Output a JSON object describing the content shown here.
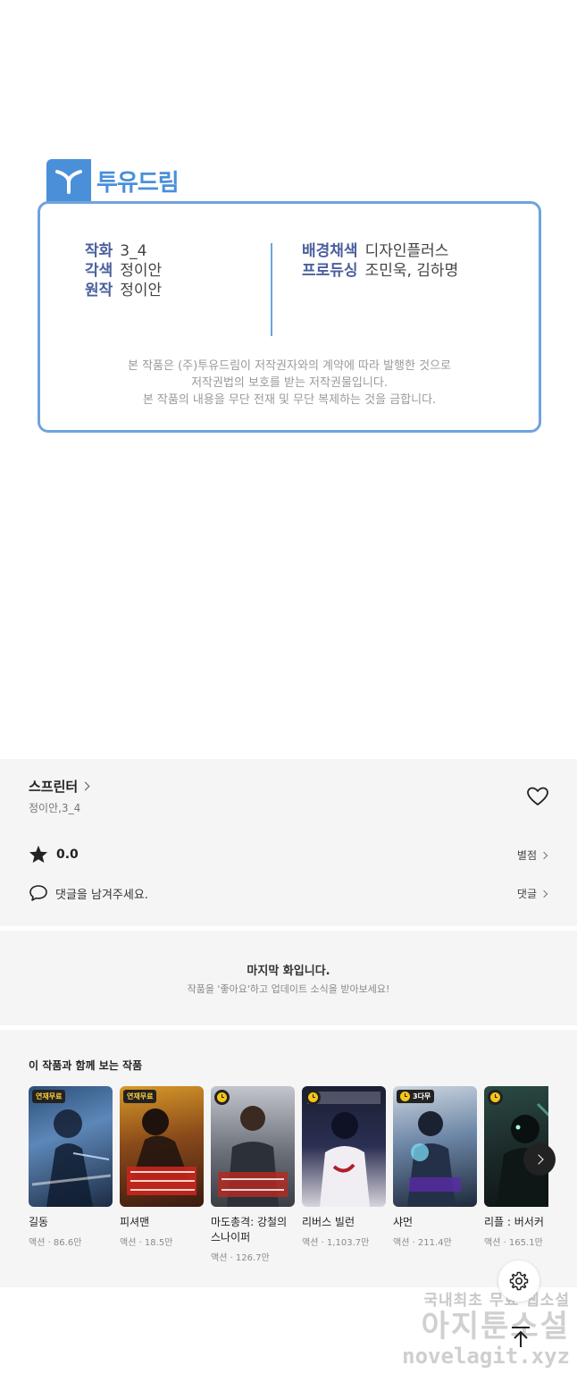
{
  "credit": {
    "brand_name": "투유드림",
    "left_rows": [
      {
        "label": "작화",
        "value": "3_4"
      },
      {
        "label": "각색",
        "value": "정이안"
      },
      {
        "label": "원작",
        "value": "정이안"
      }
    ],
    "right_rows": [
      {
        "label": "배경채색",
        "value": "디자인플러스"
      },
      {
        "label": "프로듀싱",
        "value": "조민욱, 김하명"
      }
    ],
    "notice": [
      "본 작품은 (주)투유드림이 저작권자와의 계약에 따라 발행한 것으로",
      "저작권법의 보호를 받는 저작권물입니다.",
      "본 작품의 내용을 무단 전재 및 무단 복제하는 것을 금합니다."
    ]
  },
  "series": {
    "title": "스프린터",
    "author": "정이안,3_4",
    "rating": "0.0",
    "rating_link": "별점",
    "comment_prompt": "댓글을 남겨주세요.",
    "comment_link": "댓글"
  },
  "last_episode": {
    "title": "마지막 화입니다.",
    "subtitle": "작품을 '좋아요'하고 업데이트 소식을 받아보세요!"
  },
  "recommendations": {
    "heading": "이 작품과 함께 보는 작품",
    "items": [
      {
        "title": "길동",
        "meta": "액션 · 86.6만",
        "badge": "연재무료"
      },
      {
        "title": "피셔맨",
        "meta": "액션 · 18.5만",
        "badge": "연재무료"
      },
      {
        "title": "마도총격: 강철의 스나이퍼",
        "meta": "액션 · 126.7만",
        "badge": ""
      },
      {
        "title": "리버스 빌런",
        "meta": "액션 · 1,103.7만",
        "badge": ""
      },
      {
        "title": "샤먼",
        "meta": "액션 · 211.4만",
        "badge": "3다무"
      },
      {
        "title": "리플 : 버서커",
        "meta": "액션 · 165.1만",
        "badge": ""
      }
    ]
  },
  "watermark": {
    "line1": "국내최초 무료 웹소설",
    "line2": "아지툰소설",
    "line3": "novelagit.xyz"
  },
  "colors": {
    "brand_blue": "#4a90d9",
    "credit_label": "#4a5f9e",
    "badge_yellow": "#ffd23c"
  },
  "icons": [
    "heart-icon",
    "star-icon",
    "comment-icon",
    "chevron-right-icon",
    "gear-icon",
    "arrow-up-icon",
    "clock-icon"
  ]
}
